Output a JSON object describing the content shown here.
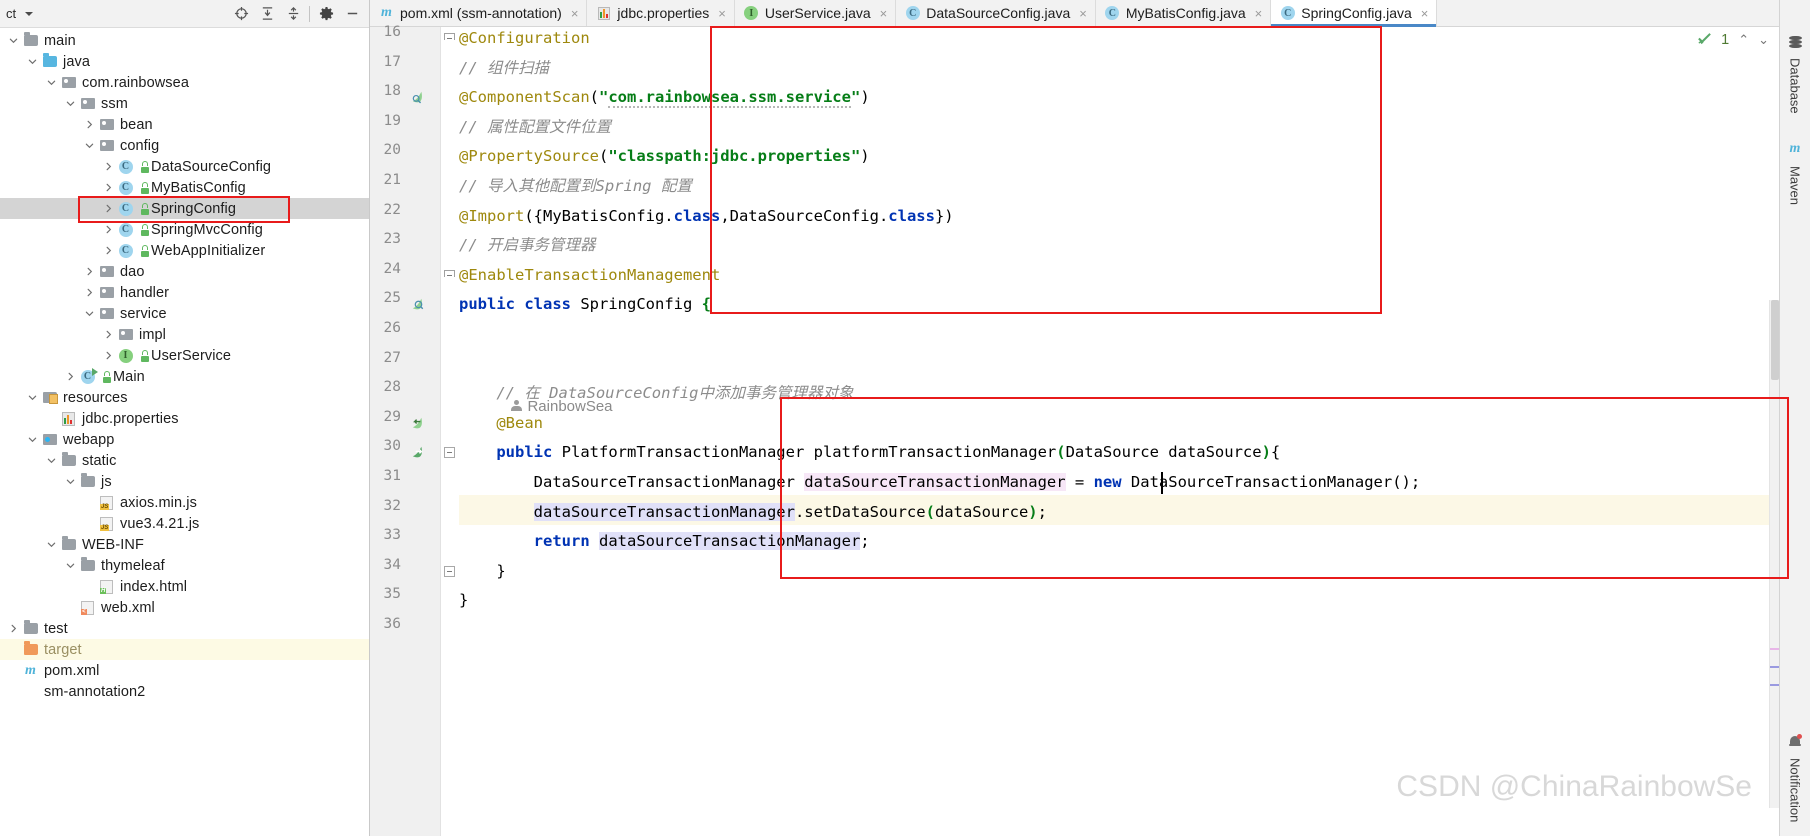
{
  "project": {
    "toolbar": {
      "title": "ct",
      "buttons": [
        {
          "name": "locate-icon",
          "label": "⊕"
        },
        {
          "name": "expand-all-icon",
          "label": "⇟"
        },
        {
          "name": "collapse-all-icon",
          "label": "⇞"
        },
        {
          "name": "settings-gear-icon",
          "label": "✿"
        },
        {
          "name": "hide-panel-icon",
          "label": "—"
        }
      ]
    },
    "tree": [
      {
        "label": "main",
        "indent": 0,
        "arrow": "down",
        "icon": "folder-grey",
        "lock": false,
        "selected": false,
        "state": "normal"
      },
      {
        "label": "java",
        "indent": 1,
        "arrow": "down",
        "icon": "folder-blue",
        "lock": false,
        "selected": false,
        "state": "normal"
      },
      {
        "label": "com.rainbowsea",
        "indent": 2,
        "arrow": "down",
        "icon": "package",
        "lock": false,
        "selected": false,
        "state": "normal"
      },
      {
        "label": "ssm",
        "indent": 3,
        "arrow": "down",
        "icon": "package",
        "lock": false,
        "selected": false,
        "state": "normal"
      },
      {
        "label": "bean",
        "indent": 4,
        "arrow": "right",
        "icon": "package",
        "lock": false,
        "selected": false,
        "state": "normal"
      },
      {
        "label": "config",
        "indent": 4,
        "arrow": "down",
        "icon": "package",
        "lock": false,
        "selected": false,
        "state": "normal"
      },
      {
        "label": "DataSourceConfig",
        "indent": 5,
        "arrow": "right",
        "icon": "class",
        "lock": true,
        "selected": false,
        "state": "normal"
      },
      {
        "label": "MyBatisConfig",
        "indent": 5,
        "arrow": "right",
        "icon": "class",
        "lock": true,
        "selected": false,
        "state": "normal"
      },
      {
        "label": "SpringConfig",
        "indent": 5,
        "arrow": "right",
        "icon": "class",
        "lock": true,
        "selected": true,
        "state": "normal"
      },
      {
        "label": "SpringMvcConfig",
        "indent": 5,
        "arrow": "right",
        "icon": "class",
        "lock": true,
        "selected": false,
        "state": "normal"
      },
      {
        "label": "WebAppInitializer",
        "indent": 5,
        "arrow": "right",
        "icon": "class",
        "lock": true,
        "selected": false,
        "state": "normal"
      },
      {
        "label": "dao",
        "indent": 4,
        "arrow": "right",
        "icon": "package",
        "lock": false,
        "selected": false,
        "state": "normal"
      },
      {
        "label": "handler",
        "indent": 4,
        "arrow": "right",
        "icon": "package",
        "lock": false,
        "selected": false,
        "state": "normal"
      },
      {
        "label": "service",
        "indent": 4,
        "arrow": "down",
        "icon": "package",
        "lock": false,
        "selected": false,
        "state": "normal"
      },
      {
        "label": "impl",
        "indent": 5,
        "arrow": "right",
        "icon": "package",
        "lock": false,
        "selected": false,
        "state": "normal"
      },
      {
        "label": "UserService",
        "indent": 5,
        "arrow": "right",
        "icon": "interface",
        "lock": true,
        "selected": false,
        "state": "normal"
      },
      {
        "label": "Main",
        "indent": 3,
        "arrow": "right",
        "icon": "class-main",
        "lock": true,
        "selected": false,
        "state": "normal"
      },
      {
        "label": "resources",
        "indent": 1,
        "arrow": "down",
        "icon": "folder-res",
        "lock": false,
        "selected": false,
        "state": "normal"
      },
      {
        "label": "jdbc.properties",
        "indent": 2,
        "arrow": "none",
        "icon": "file-properties",
        "lock": false,
        "selected": false,
        "state": "normal"
      },
      {
        "label": "webapp",
        "indent": 1,
        "arrow": "down",
        "icon": "folder-webapp",
        "lock": false,
        "selected": false,
        "state": "normal"
      },
      {
        "label": "static",
        "indent": 2,
        "arrow": "down",
        "icon": "folder-grey",
        "lock": false,
        "selected": false,
        "state": "normal"
      },
      {
        "label": "js",
        "indent": 3,
        "arrow": "down",
        "icon": "folder-grey",
        "lock": false,
        "selected": false,
        "state": "normal"
      },
      {
        "label": "axios.min.js",
        "indent": 4,
        "arrow": "none",
        "icon": "file-js",
        "lock": false,
        "selected": false,
        "state": "normal"
      },
      {
        "label": "vue3.4.21.js",
        "indent": 4,
        "arrow": "none",
        "icon": "file-js",
        "lock": false,
        "selected": false,
        "state": "normal"
      },
      {
        "label": "WEB-INF",
        "indent": 2,
        "arrow": "down",
        "icon": "folder-grey",
        "lock": false,
        "selected": false,
        "state": "normal"
      },
      {
        "label": "thymeleaf",
        "indent": 3,
        "arrow": "down",
        "icon": "folder-grey",
        "lock": false,
        "selected": false,
        "state": "normal"
      },
      {
        "label": "index.html",
        "indent": 4,
        "arrow": "none",
        "icon": "file-html",
        "lock": false,
        "selected": false,
        "state": "normal"
      },
      {
        "label": "web.xml",
        "indent": 3,
        "arrow": "none",
        "icon": "file-xml",
        "lock": false,
        "selected": false,
        "state": "normal"
      },
      {
        "label": "test",
        "indent": 0,
        "arrow": "right",
        "icon": "folder-grey",
        "lock": false,
        "selected": false,
        "state": "normal"
      },
      {
        "label": "target",
        "indent": 0,
        "arrow": "none",
        "icon": "folder-orange",
        "lock": false,
        "selected": false,
        "state": "buildout"
      },
      {
        "label": "pom.xml",
        "indent": 0,
        "arrow": "none",
        "icon": "maven",
        "lock": false,
        "selected": false,
        "state": "normal"
      },
      {
        "label": "sm-annotation2",
        "indent": 0,
        "arrow": "none",
        "icon": "none",
        "lock": false,
        "selected": false,
        "state": "normal"
      }
    ]
  },
  "tabs": [
    {
      "label": "pom.xml (ssm-annotation)",
      "icon": "maven-m-icon",
      "active": false,
      "close": "×"
    },
    {
      "label": "jdbc.properties",
      "icon": "properties-icon",
      "active": false,
      "close": "×"
    },
    {
      "label": "UserService.java",
      "icon": "interface-icon",
      "active": false,
      "close": "×"
    },
    {
      "label": "DataSourceConfig.java",
      "icon": "class-icon",
      "active": false,
      "close": "×"
    },
    {
      "label": "MyBatisConfig.java",
      "icon": "class-icon",
      "active": false,
      "close": "×"
    },
    {
      "label": "SpringConfig.java",
      "icon": "class-icon",
      "active": true,
      "close": "×"
    }
  ],
  "tab_overflow": "⋮",
  "inspection": {
    "count": "1",
    "prev": "⌃",
    "next": "⌄"
  },
  "editor": {
    "first_line": 16,
    "lines": [
      {
        "n": 16,
        "text": "@Configuration"
      },
      {
        "n": 17,
        "text": "// 组件扫描"
      },
      {
        "n": 18,
        "text": "@ComponentScan(\"com.rainbowsea.ssm.service\")"
      },
      {
        "n": 19,
        "text": "// 属性配置文件位置"
      },
      {
        "n": 20,
        "text": "@PropertySource(\"classpath:jdbc.properties\")"
      },
      {
        "n": 21,
        "text": "// 导入其他配置到Spring 配置"
      },
      {
        "n": 22,
        "text": "@Import({MyBatisConfig.class,DataSourceConfig.class})"
      },
      {
        "n": 23,
        "text": "// 开启事务管理器"
      },
      {
        "n": 24,
        "text": "@EnableTransactionManagement"
      },
      {
        "n": 25,
        "text": "public class SpringConfig {"
      },
      {
        "n": 26,
        "text": ""
      },
      {
        "n": 27,
        "text": ""
      },
      {
        "n": 28,
        "text": "    // 在 DataSourceConfig中添加事务管理器对象"
      },
      {
        "n": 29,
        "text": "    @Bean"
      },
      {
        "n": 30,
        "text": "    public PlatformTransactionManager platformTransactionManager(DataSource dataSource){"
      },
      {
        "n": 31,
        "text": "        DataSourceTransactionManager dataSourceTransactionManager = new DataSourceTransactionManager();"
      },
      {
        "n": 32,
        "text": "        dataSourceTransactionManager.setDataSource(dataSource);"
      },
      {
        "n": 33,
        "text": "        return dataSourceTransactionManager;"
      },
      {
        "n": 34,
        "text": "    }"
      },
      {
        "n": 35,
        "text": "}"
      },
      {
        "n": 36,
        "text": ""
      }
    ],
    "inlay_hint": "RainbowSea",
    "caret_line": 31
  },
  "right_sidebar": {
    "tools": [
      {
        "label": "Database",
        "icon": "database-icon"
      },
      {
        "label": "Maven",
        "icon": "maven-m-icon"
      },
      {
        "label": "Notification",
        "icon": "bell-icon"
      }
    ]
  },
  "watermark": "CSDN @ChinaRainbowSe",
  "colors": {
    "annotation_box": "#e81b1b",
    "accent_tab": "#4a88c7",
    "keyword": "#0033b3",
    "string": "#067d17",
    "annotation": "#9e880d",
    "comment": "#8c8c8c",
    "caret_line": "#fcf8e6",
    "selection": "#e0e0f8",
    "identifier_highlight": "#f7e7f7"
  }
}
